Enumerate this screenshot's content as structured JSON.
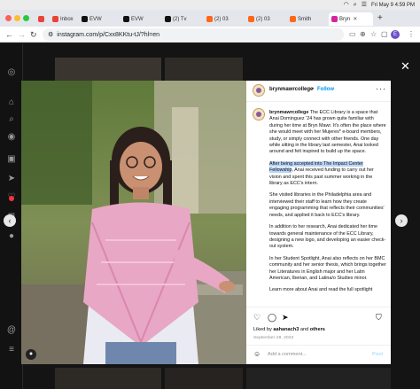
{
  "menubar": {
    "datetime": "Fri May 9  4:59 PM",
    "icons": [
      "wifi-icon",
      "search-icon",
      "control-center-icon"
    ]
  },
  "tabs": [
    {
      "label": "M",
      "icon": "gmail-icon",
      "color": "#ea4335"
    },
    {
      "label": "Inbox",
      "icon": "gmail-icon",
      "color": "#ea4335"
    },
    {
      "label": "EVW",
      "icon": "x-icon",
      "color": "#111111"
    },
    {
      "label": "EVW",
      "icon": "x-icon",
      "color": "#111111"
    },
    {
      "label": "(2) Tv",
      "icon": "x-icon",
      "color": "#111111"
    },
    {
      "label": "(2) 03",
      "icon": "substack-icon",
      "color": "#ff6719"
    },
    {
      "label": "(2) 03",
      "icon": "substack-icon",
      "color": "#ff6719"
    },
    {
      "label": "Smith",
      "icon": "substack-icon",
      "color": "#ff6719"
    },
    {
      "label": "Bryn",
      "icon": "instagram-icon",
      "color": "#d6249f"
    }
  ],
  "address": {
    "url": "instagram.com/p/Cxx8KKtu-tJ/?hl=en",
    "profile_initial": "E"
  },
  "post": {
    "username": "brynmawrcollege",
    "follow": "Follow",
    "dot": "•",
    "caption": [
      {
        "user": "brynmawrcollege",
        "text": "The ECC Library is a space that Anai Dominguez ’24 has grown quite familiar with during her time at Bryn Mawr. It's often the place where she would meet with her Mujeres* e-board members, study, or simply connect with other friends. One day while sitting in the library last semester, Anai looked around and felt inspired to build up the space."
      },
      {
        "highlight": "After being accepted into The Impact Center Fellowship",
        "text": ", Anai received funding to carry out her vision and spent this past summer working in the library as ECC's intern."
      },
      {
        "text": "She visited libraries in the Philadelphia area and interviewed their staff to learn how they create engaging programming that reflects their communities' needs, and applied it back to ECC's library."
      },
      {
        "text": "In addition to her research, Anai dedicated her time towards general maintenance of the ECC Library, designing a new logo, and developing an easier check-out system."
      },
      {
        "text": "In her Student Spotlight, Anai also reflects on her BMC community and her senior thesis, which brings together her Literatures in English major and her Latin American, Iberian, and Latina/o Studies minor."
      },
      {
        "text": "Learn more about Anai and read the full spotlight"
      }
    ],
    "likes_prefix": "Liked by ",
    "likes_user": "aahanach3",
    "likes_mid": " and ",
    "likes_others": "others",
    "date": "September 29, 2023",
    "comment_placeholder": "Add a comment...",
    "post_label": "Post"
  }
}
